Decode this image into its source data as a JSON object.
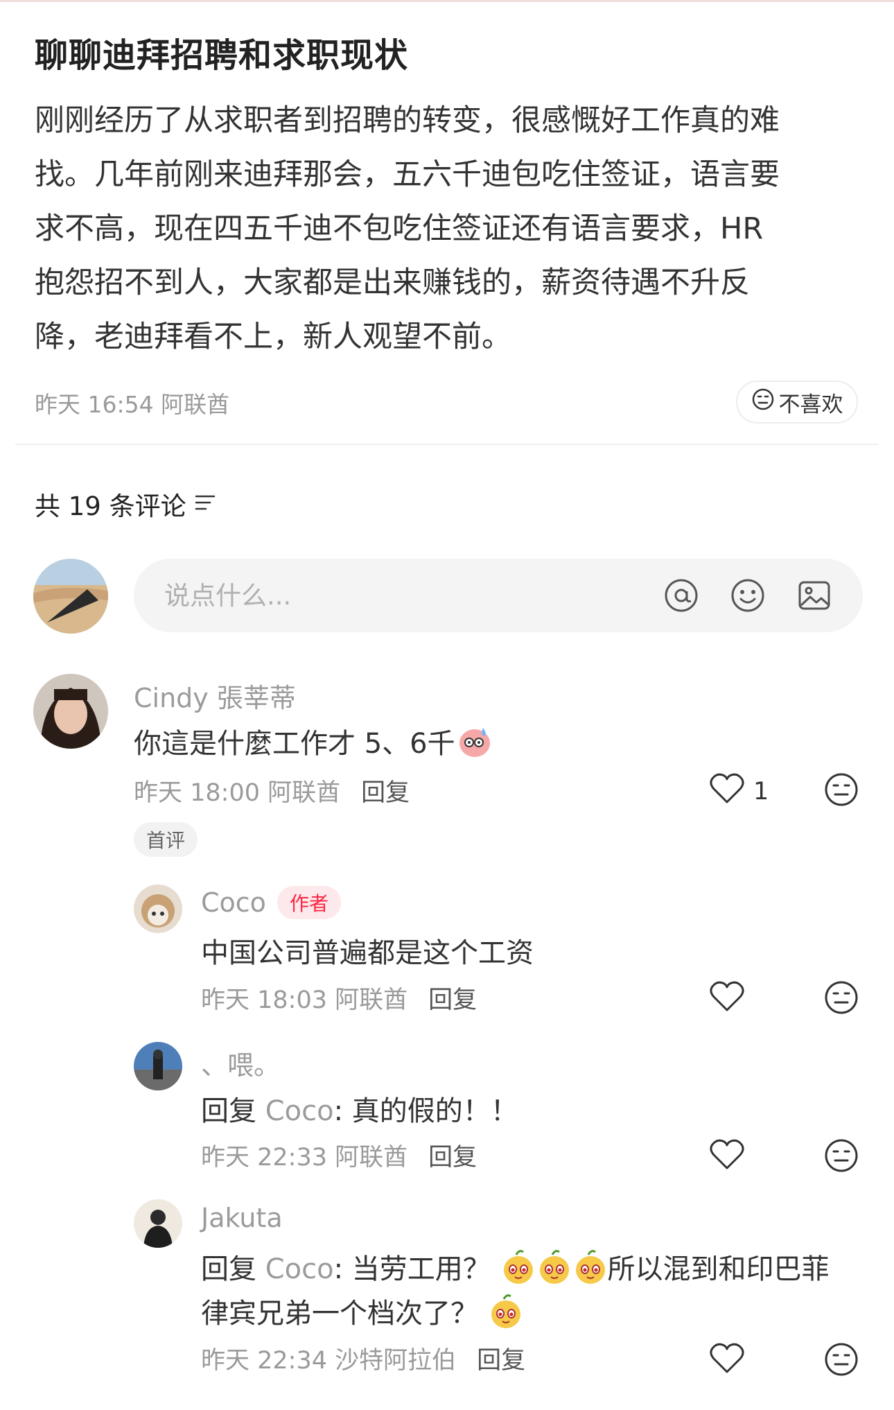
{
  "post": {
    "title": "聊聊迪拜招聘和求职现状",
    "body_lines": [
      "刚刚经历了从求职者到招聘的转变，很感慨好工作真的难",
      "找。几年前刚来迪拜那会，五六千迪包吃住签证，语言要",
      "求不高，现在四五千迪不包吃住签证还有语言要求，HR",
      "抱怨招不到人，大家都是出来赚钱的，薪资待遇不升反",
      "降，老迪拜看不上，新人观望不前。"
    ],
    "meta": "昨天 16:54 阿联酋",
    "dislike_label": "不喜欢"
  },
  "comments_header": {
    "count_text": "共 19 条评论"
  },
  "input": {
    "placeholder": "说点什么..."
  },
  "comments": [
    {
      "author": "Cindy 張莘蒂",
      "text": "你這是什麼工作才 5、6千",
      "meta": "昨天 18:00 阿联酋",
      "reply_label": "回复",
      "likes": "1",
      "badge": "首评"
    }
  ],
  "replies": [
    {
      "author": "Coco",
      "author_badge": "作者",
      "text": "中国公司普遍都是这个工资",
      "meta": "昨天 18:03 阿联酋",
      "reply_label": "回复"
    },
    {
      "author": "、喂。",
      "reply_prefix": "回复",
      "reply_target": "Coco",
      "text": ": 真的假的！！",
      "meta": "昨天 22:33 阿联酋",
      "reply_label": "回复"
    },
    {
      "author": "Jakuta",
      "reply_prefix": "回复",
      "reply_target": "Coco",
      "text_part1": ": 当劳工用？",
      "text_part2": "所以混到和印巴菲",
      "text_line2": "律宾兄弟一个档次了？",
      "meta": "昨天 22:34 沙特阿拉伯",
      "reply_label": "回复"
    }
  ],
  "colors": {
    "accent": "#ff2442",
    "muted": "#9a9a9a"
  },
  "icons": [
    "neutral-face-icon",
    "filter-icon",
    "at-icon",
    "smile-icon",
    "image-icon",
    "heart-icon",
    "sweat-emoji-icon",
    "mango-emoji-icon"
  ]
}
